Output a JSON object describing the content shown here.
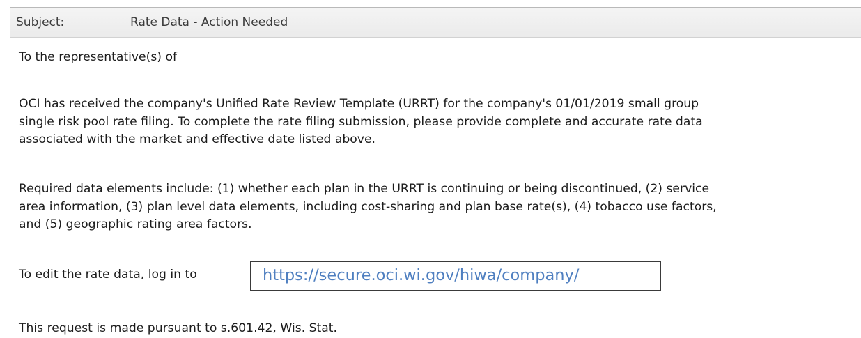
{
  "subject": {
    "label": "Subject:",
    "value": "Rate Data - Action Needed"
  },
  "body": {
    "greeting": "To the representative(s) of",
    "paragraph1": [
      "OCI has received the company's Unified Rate Review Template (URRT) for the company's 01/01/2019 small group",
      "single risk pool rate filing. To complete the rate filing submission, please provide complete and accurate rate data",
      "associated with the market and effective date listed above."
    ],
    "paragraph2": [
      "Required data elements include: (1) whether each plan in the URRT is continuing or being discontinued, (2) service",
      "area information, (3) plan level data elements, including cost-sharing and plan base rate(s), (4) tobacco use factors,",
      "and (5) geographic rating area factors."
    ],
    "login_prefix": "To edit the rate data, log in to",
    "login_url": "https://secure.oci.wi.gov/hiwa/company/",
    "closing": "This request is made pursuant to s.601.42, Wis. Stat."
  }
}
